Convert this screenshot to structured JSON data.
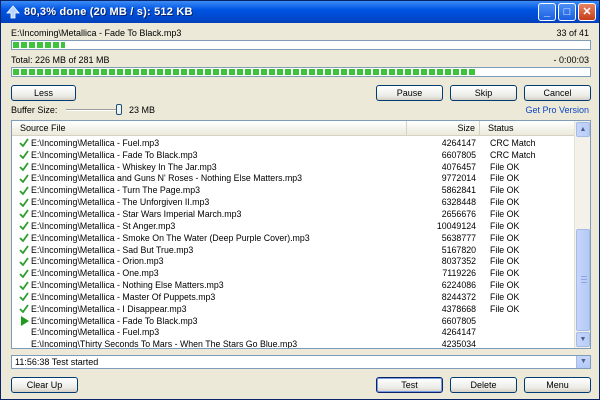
{
  "window": {
    "title": "80,3% done (20 MB / s): 512 KB"
  },
  "current": {
    "file": "E:\\Incoming\\Metallica - Fade To Black.mp3",
    "count": "33 of 41",
    "progress": 0.09
  },
  "total": {
    "label": "Total: 226 MB of 281 MB",
    "time": "- 0:00:03",
    "progress": 0.803
  },
  "controls": {
    "less": "Less",
    "pause": "Pause",
    "skip": "Skip",
    "cancel": "Cancel"
  },
  "buffer": {
    "label": "Buffer Size:",
    "value": "23 MB",
    "level": 1.0
  },
  "get_pro": "Get Pro Version",
  "table": {
    "headers": {
      "source": "Source File",
      "size": "Size",
      "status": "Status"
    },
    "rows": [
      {
        "icon": "check",
        "src": "E:\\Incoming\\Metallica - Fuel.mp3",
        "size": "4264147",
        "status": "CRC Match"
      },
      {
        "icon": "check",
        "src": "E:\\Incoming\\Metallica - Fade To Black.mp3",
        "size": "6607805",
        "status": "CRC Match"
      },
      {
        "icon": "check",
        "src": "E:\\Incoming\\Metallica - Whiskey In The Jar.mp3",
        "size": "4076457",
        "status": "File OK"
      },
      {
        "icon": "check",
        "src": "E:\\Incoming\\Metallica and Guns N' Roses - Nothing Else Matters.mp3",
        "size": "9772014",
        "status": "File OK"
      },
      {
        "icon": "check",
        "src": "E:\\Incoming\\Metallica - Turn The Page.mp3",
        "size": "5862841",
        "status": "File OK"
      },
      {
        "icon": "check",
        "src": "E:\\Incoming\\Metallica - The Unforgiven II.mp3",
        "size": "6328448",
        "status": "File OK"
      },
      {
        "icon": "check",
        "src": "E:\\Incoming\\Metallica - Star Wars Imperial March.mp3",
        "size": "2656676",
        "status": "File OK"
      },
      {
        "icon": "check",
        "src": "E:\\Incoming\\Metallica - St Anger.mp3",
        "size": "10049124",
        "status": "File OK"
      },
      {
        "icon": "check",
        "src": "E:\\Incoming\\Metallica - Smoke On The Water (Deep Purple Cover).mp3",
        "size": "5638777",
        "status": "File OK"
      },
      {
        "icon": "check",
        "src": "E:\\Incoming\\Metallica - Sad But True.mp3",
        "size": "5167820",
        "status": "File OK"
      },
      {
        "icon": "check",
        "src": "E:\\Incoming\\Metallica - Orion.mp3",
        "size": "8037352",
        "status": "File OK"
      },
      {
        "icon": "check",
        "src": "E:\\Incoming\\Metallica - One.mp3",
        "size": "7119226",
        "status": "File OK"
      },
      {
        "icon": "check",
        "src": "E:\\Incoming\\Metallica - Nothing Else Matters.mp3",
        "size": "6224086",
        "status": "File OK"
      },
      {
        "icon": "check",
        "src": "E:\\Incoming\\Metallica - Master Of Puppets.mp3",
        "size": "8244372",
        "status": "File OK"
      },
      {
        "icon": "check",
        "src": "E:\\Incoming\\Metallica - I Disappear.mp3",
        "size": "4378668",
        "status": "File OK"
      },
      {
        "icon": "play",
        "src": "E:\\Incoming\\Metallica - Fade To Black.mp3",
        "size": "6607805",
        "status": ""
      },
      {
        "icon": "none",
        "src": "E:\\Incoming\\Metallica - Fuel.mp3",
        "size": "4264147",
        "status": ""
      },
      {
        "icon": "none",
        "src": "E:\\Incoming\\Thirty Seconds To Mars - When The Stars Go Blue.mp3",
        "size": "4235034",
        "status": ""
      }
    ]
  },
  "log": {
    "text": "11:56:38 Test started"
  },
  "footer": {
    "clear_up": "Clear Up",
    "test": "Test",
    "delete": "Delete",
    "menu": "Menu"
  },
  "colors": {
    "title_bar": "#0054e3",
    "progress": "#3fc33f",
    "check": "#2e9e2e",
    "link": "#0b47c1"
  }
}
